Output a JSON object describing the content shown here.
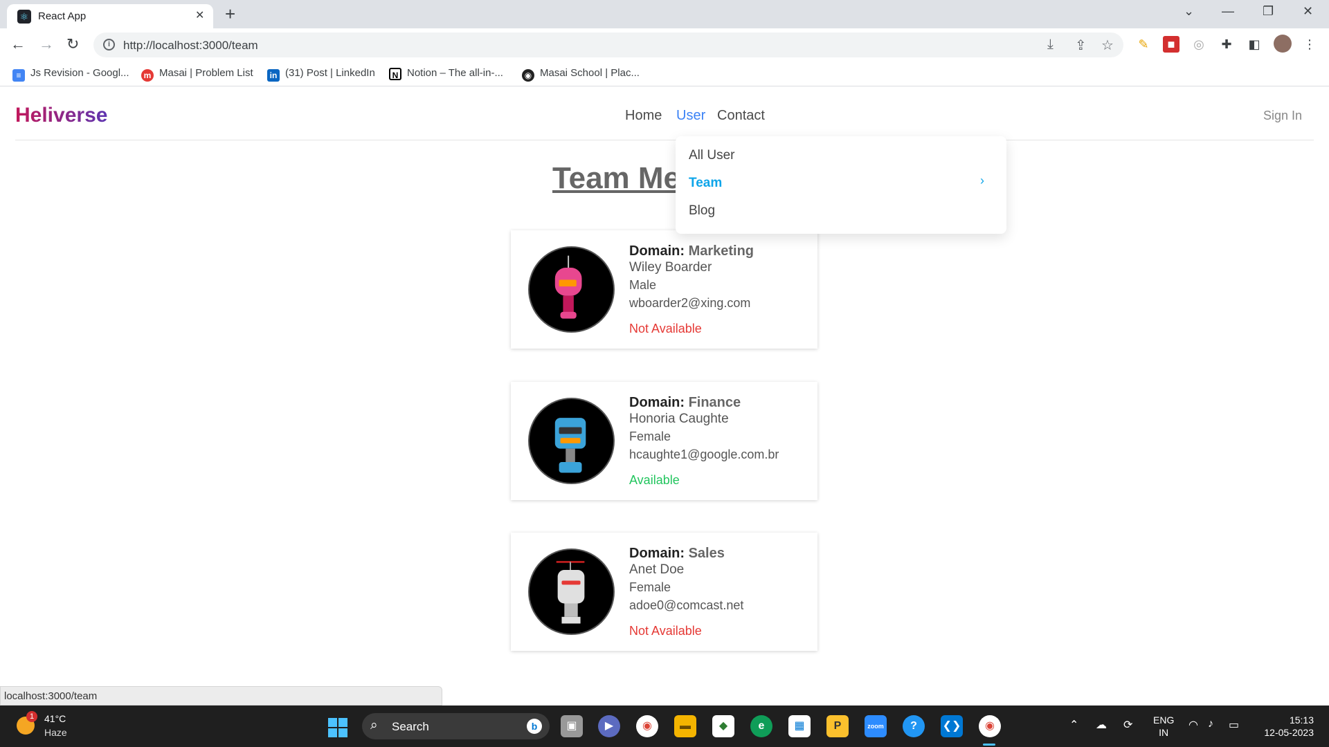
{
  "browser": {
    "tab_title": "React App",
    "url": "http://localhost:3000/team",
    "bookmarks": [
      {
        "label": "Js Revision - Googl...",
        "icon": "google-docs-icon",
        "color": "#4285f4"
      },
      {
        "label": "Masai | Problem List",
        "icon": "masai-icon",
        "color": "#e53935"
      },
      {
        "label": "(31) Post | LinkedIn",
        "icon": "linkedin-icon",
        "color": "#0a66c2"
      },
      {
        "label": "Notion – The all-in-...",
        "icon": "notion-icon",
        "color": "#000000"
      },
      {
        "label": "Masai School | Plac...",
        "icon": "globe-icon",
        "color": "#000000"
      }
    ],
    "status_url": "localhost:3000/team"
  },
  "navbar": {
    "brand": "Heliverse",
    "links": [
      "Home",
      "User",
      "Contact"
    ],
    "active_link": "User",
    "signin": "Sign In"
  },
  "dropdown": {
    "items": [
      "All User",
      "Team",
      "Blog"
    ],
    "active_item": "Team"
  },
  "page": {
    "title": "Team Me",
    "domain_label": "Domain:"
  },
  "members": [
    {
      "domain": "Marketing",
      "name": "Wiley Boarder",
      "gender": "Male",
      "email": "wboarder2@xing.com",
      "status": "Not Available",
      "status_color": "#e53935",
      "robot_color": "#e8478f"
    },
    {
      "domain": "Finance",
      "name": "Honoria Caughte",
      "gender": "Female",
      "email": "hcaughte1@google.com.br",
      "status": "Available",
      "status_color": "#22c55e",
      "robot_color": "#3ba3d9"
    },
    {
      "domain": "Sales",
      "name": "Anet Doe",
      "gender": "Female",
      "email": "adoe0@comcast.net",
      "status": "Not Available",
      "status_color": "#e53935",
      "robot_color": "#e0e0e0"
    }
  ],
  "taskbar": {
    "temp": "41°C",
    "weather": "Haze",
    "weather_badge": "1",
    "search": "Search",
    "lang_line1": "ENG",
    "lang_line2": "IN",
    "time": "15:13",
    "date": "12-05-2023"
  },
  "colors": {
    "accent": "#3b82f6",
    "dropdown_active": "#0ea5e9"
  }
}
